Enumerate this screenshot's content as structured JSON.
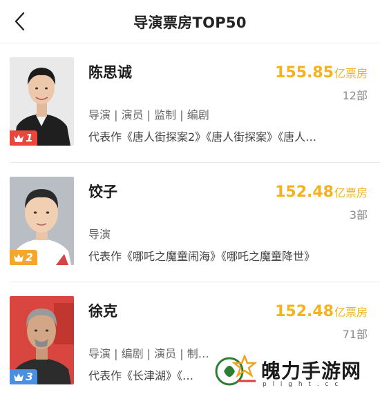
{
  "header": {
    "title": "导演票房TOP50"
  },
  "directors": [
    {
      "rank": "1",
      "name": "陈思诚",
      "box_office": "155.85",
      "box_unit": "亿票房",
      "films": "12部",
      "roles": "导演 | 演员 | 监制 | 编剧",
      "works": "代表作《唐人街探案2》《唐人街探案》《唐人…",
      "badge_color": "#e8483b"
    },
    {
      "rank": "2",
      "name": "饺子",
      "box_office": "152.48",
      "box_unit": "亿票房",
      "films": "3部",
      "roles": "导演",
      "works": "代表作《哪吒之魔童闹海》《哪吒之魔童降世》",
      "badge_color": "#f3a82d"
    },
    {
      "rank": "3",
      "name": "徐克",
      "box_office": "152.48",
      "box_unit": "亿票房",
      "films": "71部",
      "roles": "导演 | 编剧 | 演员 | 制…",
      "works": "代表作《长津湖》《…",
      "badge_color": "#4a90e2"
    }
  ],
  "watermark": {
    "text": "魄力手游网",
    "url": "p l i g h t . c c"
  }
}
